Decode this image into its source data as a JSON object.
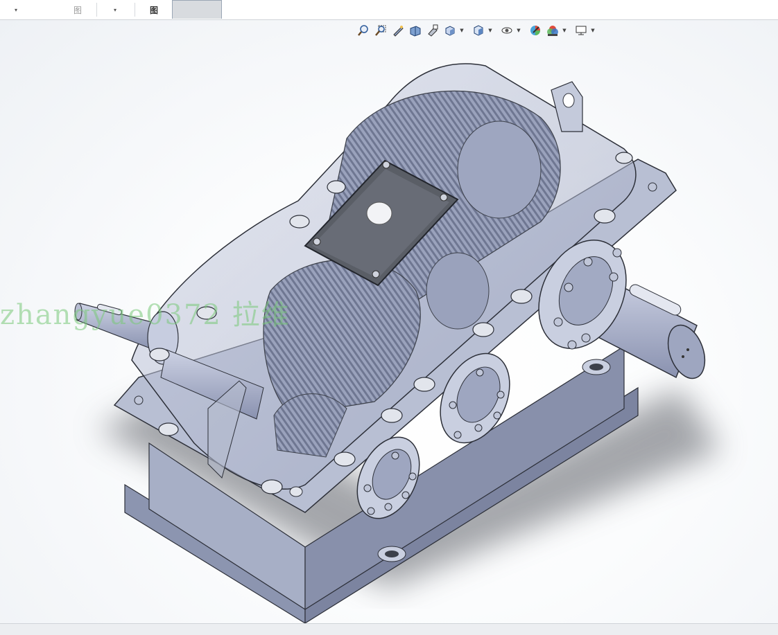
{
  "tabs": [
    {
      "label": "",
      "has_dropdown": true
    },
    {
      "label": "图",
      "has_dropdown": false
    },
    {
      "label": "",
      "has_dropdown": true
    },
    {
      "label": "图",
      "has_dropdown": false
    },
    {
      "label": "",
      "active": true
    }
  ],
  "hud_toolbar": {
    "items": [
      {
        "icon": "zoom-to-fit-icon"
      },
      {
        "icon": "zoom-to-area-icon"
      },
      {
        "icon": "previous-view-icon"
      },
      {
        "icon": "section-view-icon"
      },
      {
        "icon": "dynamic-annotation-icon"
      },
      {
        "icon": "view-orientation-icon",
        "dropdown": true
      },
      {
        "icon": "display-style-icon",
        "dropdown": true
      },
      {
        "icon": "hide-show-items-icon",
        "dropdown": true
      },
      {
        "icon": "edit-appearance-icon"
      },
      {
        "icon": "apply-scene-icon",
        "dropdown": true
      },
      {
        "icon": "view-settings-icon",
        "dropdown": true
      }
    ]
  },
  "model": {
    "description_icon": "gear-reducer-3d-model",
    "colors": {
      "housing": "#9ea7bf",
      "shaft": "#9aa3c0",
      "gear": "#8a93ad",
      "cover_plate": "#5a5e66"
    }
  },
  "watermark": {
    "text": "zhangyue0372 拉维"
  }
}
